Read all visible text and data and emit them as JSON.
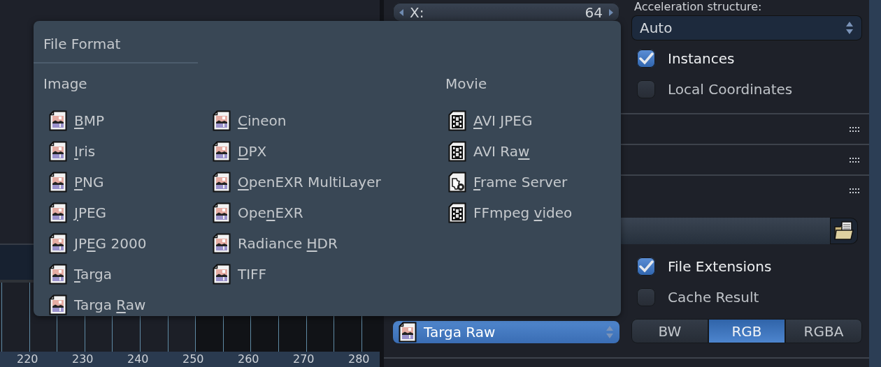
{
  "timeline": {
    "ruler_labels": [
      "220",
      "230",
      "240",
      "250",
      "260",
      "270",
      "280"
    ]
  },
  "properties": {
    "resolution_field": {
      "label": "X:",
      "value": "64"
    },
    "acceleration": {
      "label": "Acceleration structure:",
      "value": "Auto"
    },
    "options": [
      {
        "label": "Instances",
        "checked": true
      },
      {
        "label": "Local Coordinates",
        "checked": false
      }
    ],
    "output": {
      "right_options": [
        {
          "label": "File Extensions",
          "checked": true
        },
        {
          "label": "Cache Result",
          "checked": false
        }
      ],
      "file_format": {
        "value": "Targa Raw",
        "open": true
      },
      "color_modes": [
        {
          "label": "BW",
          "selected": false
        },
        {
          "label": "RGB",
          "selected": true
        },
        {
          "label": "RGBA",
          "selected": false
        }
      ]
    }
  },
  "popup": {
    "title": "File Format",
    "columns": [
      {
        "heading": "Image",
        "items": [
          {
            "kind": "image",
            "key": "B",
            "after": "MP"
          },
          {
            "kind": "image",
            "key": "I",
            "after": "ris"
          },
          {
            "kind": "image",
            "key": "P",
            "after": "NG"
          },
          {
            "kind": "image",
            "key": "J",
            "after": "PEG"
          },
          {
            "kind": "image",
            "before": "JP",
            "key": "E",
            "after": "G 2000"
          },
          {
            "kind": "image",
            "key": "T",
            "after": "arga"
          },
          {
            "kind": "image",
            "before": "Targa ",
            "key": "R",
            "after": "aw"
          }
        ]
      },
      {
        "items": [
          {
            "kind": "image",
            "key": "C",
            "after": "ineon"
          },
          {
            "kind": "image",
            "key": "D",
            "after": "PX"
          },
          {
            "kind": "image",
            "key": "O",
            "after": "penEXR MultiLayer"
          },
          {
            "kind": "image",
            "before": "Ope",
            "key": "n",
            "after": "EXR"
          },
          {
            "kind": "image",
            "before": "Radiance ",
            "key": "H",
            "after": "DR"
          },
          {
            "kind": "image",
            "before": "TIFF"
          }
        ]
      },
      {
        "heading": "Movie",
        "items": [
          {
            "kind": "movie",
            "key": "A",
            "after": "VI JPEG"
          },
          {
            "kind": "movie",
            "before": "AVI Ra",
            "key": "w"
          },
          {
            "kind": "server",
            "key": "F",
            "after": "rame Server"
          },
          {
            "kind": "movie",
            "before": "FFmpeg ",
            "key": "v",
            "after": "ideo"
          }
        ]
      }
    ]
  }
}
